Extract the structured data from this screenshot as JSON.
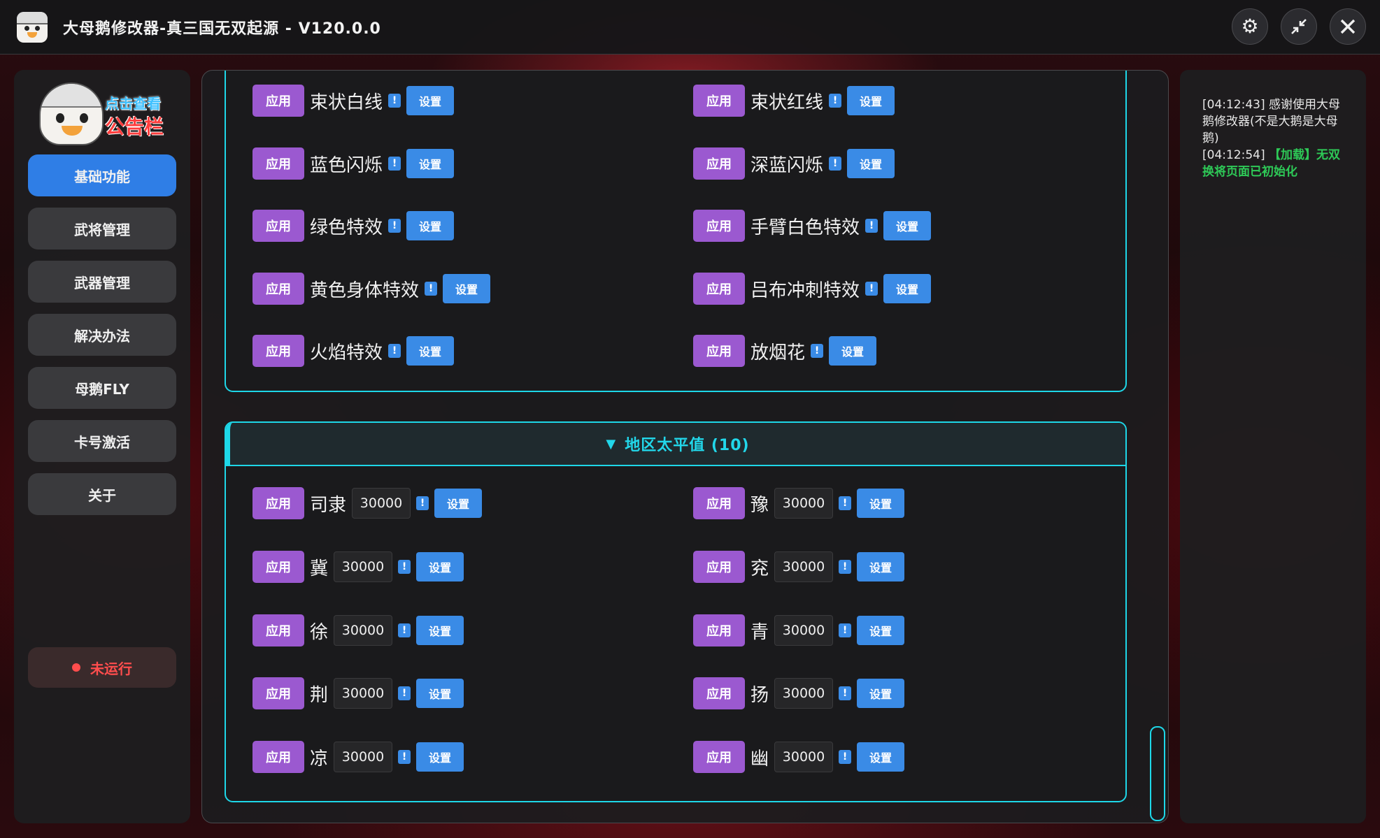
{
  "window": {
    "title": "大母鹅修改器-真三国无双起源 - V120.0.0",
    "controls": {
      "settings_icon": "gear-icon",
      "minimize_icon": "shrink-icon",
      "close_icon": "close-icon"
    }
  },
  "sidebar": {
    "logo_text_top": "点击查看",
    "logo_text_bottom": "公告栏",
    "items": [
      {
        "label": "基础功能",
        "active": true
      },
      {
        "label": "武将管理",
        "active": false
      },
      {
        "label": "武器管理",
        "active": false
      },
      {
        "label": "解决办法",
        "active": false
      },
      {
        "label": "母鹅FLY",
        "active": false
      },
      {
        "label": "卡号激活",
        "active": false
      },
      {
        "label": "关于",
        "active": false
      }
    ],
    "status": "未运行",
    "status_color": "#ff4d4d"
  },
  "main": {
    "apply_label": "应用",
    "set_label": "设置",
    "info_glyph": "!",
    "effects_left": [
      "束状白线",
      "蓝色闪烁",
      "绿色特效",
      "黄色身体特效",
      "火焰特效"
    ],
    "effects_right": [
      "束状红线",
      "深蓝闪烁",
      "手臂白色特效",
      "吕布冲刺特效",
      "放烟花"
    ],
    "region_section": {
      "title": "地区太平值 (10)",
      "left": [
        {
          "name": "司隶",
          "value": "30000"
        },
        {
          "name": "冀",
          "value": "30000"
        },
        {
          "name": "徐",
          "value": "30000"
        },
        {
          "name": "荆",
          "value": "30000"
        },
        {
          "name": "凉",
          "value": "30000"
        }
      ],
      "right": [
        {
          "name": "豫",
          "value": "30000"
        },
        {
          "name": "兖",
          "value": "30000"
        },
        {
          "name": "青",
          "value": "30000"
        },
        {
          "name": "扬",
          "value": "30000"
        },
        {
          "name": "幽",
          "value": "30000"
        }
      ]
    }
  },
  "log": {
    "entries": [
      {
        "time": "[04:12:43]",
        "text": "感谢使用大母鹅修改器(不是大鹅是大母鹅)",
        "highlight": false
      },
      {
        "time": "[04:12:54]",
        "text": "【加载】无双换将页面已初始化",
        "highlight": true
      }
    ]
  },
  "colors": {
    "accent": "#2f7ee6",
    "apply": "#9b59d0",
    "set": "#3a8be6",
    "section_border": "#1ed7e8",
    "log_highlight": "#2ec957"
  }
}
